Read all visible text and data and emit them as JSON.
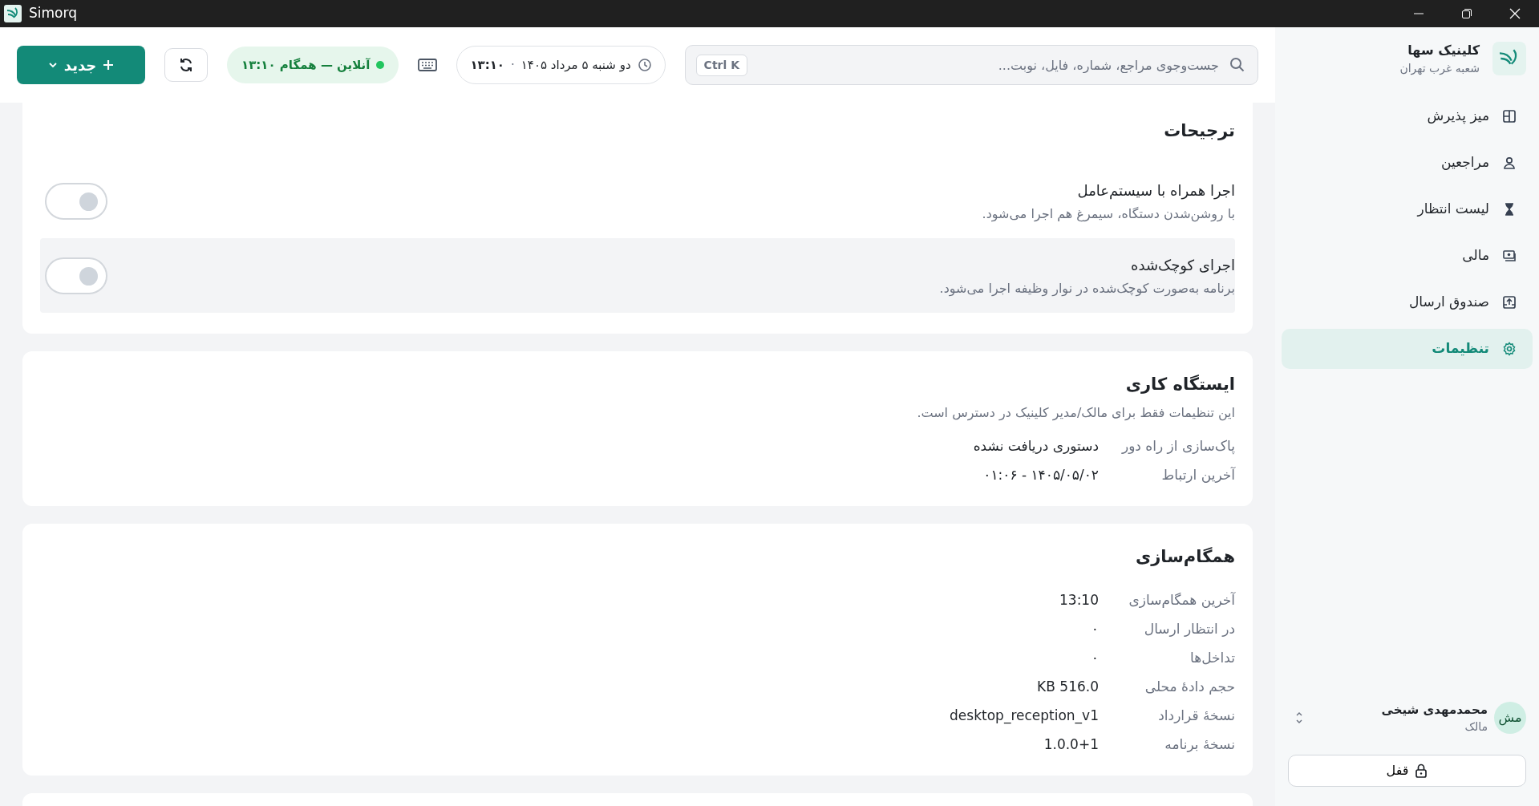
{
  "window": {
    "title": "Simorq"
  },
  "header": {
    "new_button": "جدید",
    "status": {
      "label": "آنلاین — همگام ۱۳:۱۰",
      "online": true
    },
    "date": {
      "date": "دو شنبه ۵ مرداد ۱۴۰۵",
      "separator": "·",
      "time": "۱۳:۱۰"
    },
    "search": {
      "placeholder": "جست‌وجوی مراجع، شماره، فایل، نوبت...",
      "shortcut": "Ctrl K"
    }
  },
  "sidebar": {
    "clinic": "کلینیک سها",
    "branch": "شعبه غرب تهران",
    "items": [
      {
        "label": "میز پذیرش",
        "selected": false
      },
      {
        "label": "مراجعین",
        "selected": false
      },
      {
        "label": "لیست انتظار",
        "selected": false
      },
      {
        "label": "مالی",
        "selected": false
      },
      {
        "label": "صندوق ارسال",
        "selected": false
      },
      {
        "label": "تنظیمات",
        "selected": true
      }
    ],
    "user": {
      "initials": "مش",
      "name": "محمدمهدی شیخی",
      "role": "مالک"
    },
    "lock_button": "قفل"
  },
  "preferences": {
    "title": "ترجیحات",
    "items": [
      {
        "title": "اجرا همراه با سیستم‌عامل",
        "description": "با روشن‌شدن دستگاه، سیمرغ هم اجرا می‌شود.",
        "on": false,
        "highlighted": false
      },
      {
        "title": "اجرای کوچک‌شده",
        "description": "برنامه به‌صورت کوچک‌شده در نوار وظیفه اجرا می‌شود.",
        "on": false,
        "highlighted": true
      }
    ]
  },
  "workstation": {
    "title": "ایستگاه کاری",
    "note": "این تنظیمات فقط برای مالک/مدیر کلینیک در دسترس است.",
    "rows": [
      {
        "label": "پاک‌سازی از راه دور",
        "value": "دستوری دریافت نشده"
      },
      {
        "label": "آخرین ارتباط",
        "value": "۱۴۰۵/۰۵/۰۲ - ۰۱:۰۶"
      }
    ]
  },
  "sync": {
    "title": "همگام‌سازی",
    "rows": [
      {
        "label": "آخرین همگام‌سازی",
        "value": "13:10"
      },
      {
        "label": "در انتظار ارسال",
        "value": "۰"
      },
      {
        "label": "تداخل‌ها",
        "value": "۰"
      },
      {
        "label": "حجم دادهٔ محلی",
        "value": "516.0 KB"
      },
      {
        "label": "نسخهٔ قرارداد",
        "value": "desktop_reception_v1"
      },
      {
        "label": "نسخهٔ برنامه",
        "value": "1.0.0+1"
      }
    ]
  }
}
